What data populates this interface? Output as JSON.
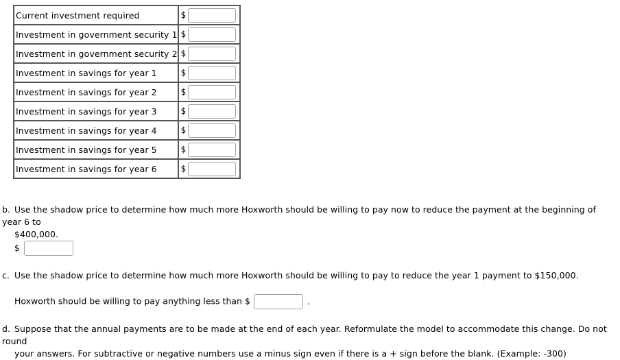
{
  "table": {
    "currency_symbol": "$",
    "rows": [
      {
        "label": "Current investment required",
        "value": ""
      },
      {
        "label": "Investment in government security 1",
        "value": ""
      },
      {
        "label": "Investment in government security 2",
        "value": ""
      },
      {
        "label": "Investment in savings for year 1",
        "value": ""
      },
      {
        "label": "Investment in savings for year 2",
        "value": ""
      },
      {
        "label": "Investment in savings for year 3",
        "value": ""
      },
      {
        "label": "Investment in savings for year 4",
        "value": ""
      },
      {
        "label": "Investment in savings for year 5",
        "value": ""
      },
      {
        "label": "Investment in savings for year 6",
        "value": ""
      }
    ]
  },
  "question_b": {
    "marker": "b.",
    "line1": "Use the shadow price to determine how much more Hoxworth should be willing to pay now to reduce the payment at the beginning of year 6 to",
    "line2": "$400,000.",
    "answer_prefix": "$",
    "answer_value": ""
  },
  "question_c": {
    "marker": "c.",
    "text": "Use the shadow price to determine how much more Hoxworth should be willing to pay to reduce the year 1 payment to $150,000.",
    "answer_prefix": "Hoxworth should be willing to pay anything less than $",
    "answer_value": "",
    "answer_suffix": "."
  },
  "question_d": {
    "marker": "d.",
    "line1": "Suppose that the annual payments are to be made at the end of each year. Reformulate the model to accommodate this change. Do not round",
    "line2": "your answers. For subtractive or negative numbers use a minus sign even if there is a + sign before the blank. (Example: -300)"
  }
}
